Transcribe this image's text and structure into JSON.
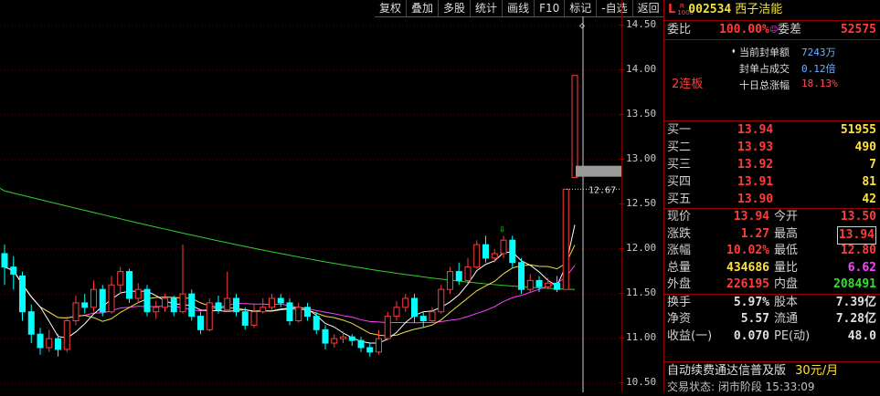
{
  "toolbar": {
    "buttons": [
      "复权",
      "叠加",
      "多股",
      "统计",
      "画线",
      "F10",
      "标记",
      "-自选",
      "返回"
    ]
  },
  "axis": {
    "ticks": [
      "14.50",
      "14.00",
      "13.50",
      "13.00",
      "12.50",
      "12.00",
      "11.50",
      "11.00",
      "10.50"
    ]
  },
  "crosshair": {
    "price_label": "12.67"
  },
  "stock": {
    "market_badge": "L",
    "r_badge_top": "R",
    "r_badge_bottom": "1000",
    "code": "002534",
    "name": "西子洁能"
  },
  "weibi": {
    "label": "委比",
    "value": "100.00%",
    "diff_label": "委差",
    "diff_value": "52575"
  },
  "seal": {
    "lianban": "2连板",
    "rows": [
      {
        "label": "当前封单额",
        "value": "7243万"
      },
      {
        "label": "封单占成交",
        "value": "0.12倍"
      },
      {
        "label": "十日总涨幅",
        "value": "18.13%"
      }
    ]
  },
  "order_book": [
    {
      "label": "买一",
      "price": "13.94",
      "volume": "51955"
    },
    {
      "label": "买二",
      "price": "13.93",
      "volume": "490"
    },
    {
      "label": "买三",
      "price": "13.92",
      "volume": "7"
    },
    {
      "label": "买四",
      "price": "13.91",
      "volume": "81"
    },
    {
      "label": "买五",
      "price": "13.90",
      "volume": "42"
    }
  ],
  "quote": {
    "rows": [
      {
        "l1": "现价",
        "v1": "13.94",
        "l2": "今开",
        "v2": "13.50"
      },
      {
        "l1": "涨跌",
        "v1": "1.27",
        "l2": "最高",
        "v2": "13.94"
      },
      {
        "l1": "涨幅",
        "v1": "10.02%",
        "l2": "最低",
        "v2": "12.80"
      },
      {
        "l1": "总量",
        "v1": "434686",
        "l2": "量比",
        "v2": "6.62"
      },
      {
        "l1": "外盘",
        "v1": "226195",
        "l2": "内盘",
        "v2": "208491"
      }
    ],
    "rows2": [
      {
        "l1": "换手",
        "v1": "5.97%",
        "l2": "股本",
        "v2": "7.39亿"
      },
      {
        "l1": "净资",
        "v1": "5.57",
        "l2": "流通",
        "v2": "7.28亿"
      },
      {
        "l1": "收益(一)",
        "v1": "0.070",
        "l2": "PE(动)",
        "v2": "48.0"
      }
    ]
  },
  "footer": {
    "ad_text": "自动续费通达信普及版",
    "ad_price": "30元/月",
    "status_text": "交易状态: 闭市阶段 15:33:09"
  },
  "colors": {
    "up": "#ff3c3c",
    "down": "#00ffff",
    "ma5": "#ffffff",
    "ma10": "#f0e040",
    "ma20": "#ff40ff",
    "ma60": "#30d030"
  },
  "chart_data": {
    "type": "candlestick",
    "y_axis": {
      "min": 10.4,
      "max": 14.6,
      "ticks": [
        14.5,
        14.0,
        13.5,
        13.0,
        12.5,
        12.0,
        11.5,
        11.0,
        10.5
      ]
    },
    "candles": [
      [
        11.95,
        11.8,
        12.05,
        11.6
      ],
      [
        11.8,
        11.72,
        11.92,
        11.55
      ],
      [
        11.7,
        11.3,
        11.75,
        11.2
      ],
      [
        11.3,
        11.05,
        11.38,
        10.95
      ],
      [
        11.05,
        10.9,
        11.12,
        10.82
      ],
      [
        10.9,
        11.0,
        11.1,
        10.85
      ],
      [
        11.0,
        10.88,
        11.05,
        10.8
      ],
      [
        10.88,
        11.2,
        11.25,
        10.85
      ],
      [
        11.2,
        11.4,
        11.48,
        11.15
      ],
      [
        11.4,
        11.35,
        11.5,
        11.28
      ],
      [
        11.35,
        11.55,
        11.65,
        11.3
      ],
      [
        11.55,
        11.3,
        11.6,
        11.25
      ],
      [
        11.3,
        11.6,
        11.7,
        11.28
      ],
      [
        11.6,
        11.75,
        11.8,
        11.5
      ],
      [
        11.75,
        11.45,
        11.78,
        11.4
      ],
      [
        11.45,
        11.55,
        11.62,
        11.4
      ],
      [
        11.55,
        11.3,
        11.6,
        11.25
      ],
      [
        11.3,
        11.35,
        11.42,
        11.22
      ],
      [
        11.35,
        11.45,
        11.5,
        11.3
      ],
      [
        11.45,
        11.3,
        11.48,
        11.25
      ],
      [
        11.3,
        11.5,
        12.05,
        11.28
      ],
      [
        11.5,
        11.25,
        11.55,
        11.2
      ],
      [
        11.25,
        11.1,
        11.3,
        11.05
      ],
      [
        11.1,
        11.4,
        11.45,
        11.08
      ],
      [
        11.4,
        11.32,
        11.48,
        11.28
      ],
      [
        11.32,
        11.45,
        11.75,
        11.3
      ],
      [
        11.45,
        11.3,
        11.5,
        11.25
      ],
      [
        11.3,
        11.15,
        11.35,
        11.1
      ],
      [
        11.15,
        11.3,
        11.38,
        11.12
      ],
      [
        11.3,
        11.35,
        11.45,
        11.28
      ],
      [
        11.35,
        11.45,
        11.5,
        11.32
      ],
      [
        11.45,
        11.4,
        11.5,
        11.35
      ],
      [
        11.4,
        11.2,
        11.45,
        11.15
      ],
      [
        11.2,
        11.35,
        11.4,
        11.18
      ],
      [
        11.35,
        11.25,
        11.4,
        11.2
      ],
      [
        11.25,
        11.1,
        11.3,
        11.05
      ],
      [
        11.1,
        10.95,
        11.15,
        10.88
      ],
      [
        10.95,
        11.0,
        11.05,
        10.9
      ],
      [
        11.0,
        11.02,
        11.08,
        10.95
      ],
      [
        11.02,
        10.98,
        11.05,
        10.92
      ],
      [
        10.98,
        10.9,
        11.02,
        10.85
      ],
      [
        10.9,
        10.85,
        10.95,
        10.8
      ],
      [
        10.85,
        11.0,
        11.1,
        10.82
      ],
      [
        11.0,
        11.25,
        11.3,
        10.98
      ],
      [
        11.25,
        11.35,
        11.42,
        11.2
      ],
      [
        11.35,
        11.45,
        11.5,
        11.3
      ],
      [
        11.45,
        11.25,
        11.5,
        11.18
      ],
      [
        11.25,
        11.2,
        11.3,
        11.12
      ],
      [
        11.2,
        11.3,
        11.35,
        11.18
      ],
      [
        11.3,
        11.55,
        11.6,
        11.28
      ],
      [
        11.55,
        11.75,
        11.8,
        11.5
      ],
      [
        11.75,
        11.65,
        11.85,
        11.6
      ],
      [
        11.65,
        11.8,
        11.9,
        11.62
      ],
      [
        11.8,
        12.05,
        12.1,
        11.78
      ],
      [
        12.05,
        11.9,
        12.15,
        11.85
      ],
      [
        11.9,
        11.95,
        12.0,
        11.85
      ],
      [
        11.95,
        12.1,
        12.15,
        11.9
      ],
      [
        12.1,
        11.85,
        12.15,
        11.8
      ],
      [
        11.85,
        11.55,
        11.9,
        11.5
      ],
      [
        11.55,
        11.65,
        11.72,
        11.52
      ],
      [
        11.65,
        11.58,
        11.7,
        11.52
      ],
      [
        11.58,
        11.62,
        11.68,
        11.55
      ],
      [
        11.62,
        11.55,
        11.7,
        11.52
      ],
      [
        11.55,
        12.67,
        12.67,
        11.55
      ],
      [
        12.8,
        13.94,
        13.94,
        12.8
      ]
    ]
  }
}
